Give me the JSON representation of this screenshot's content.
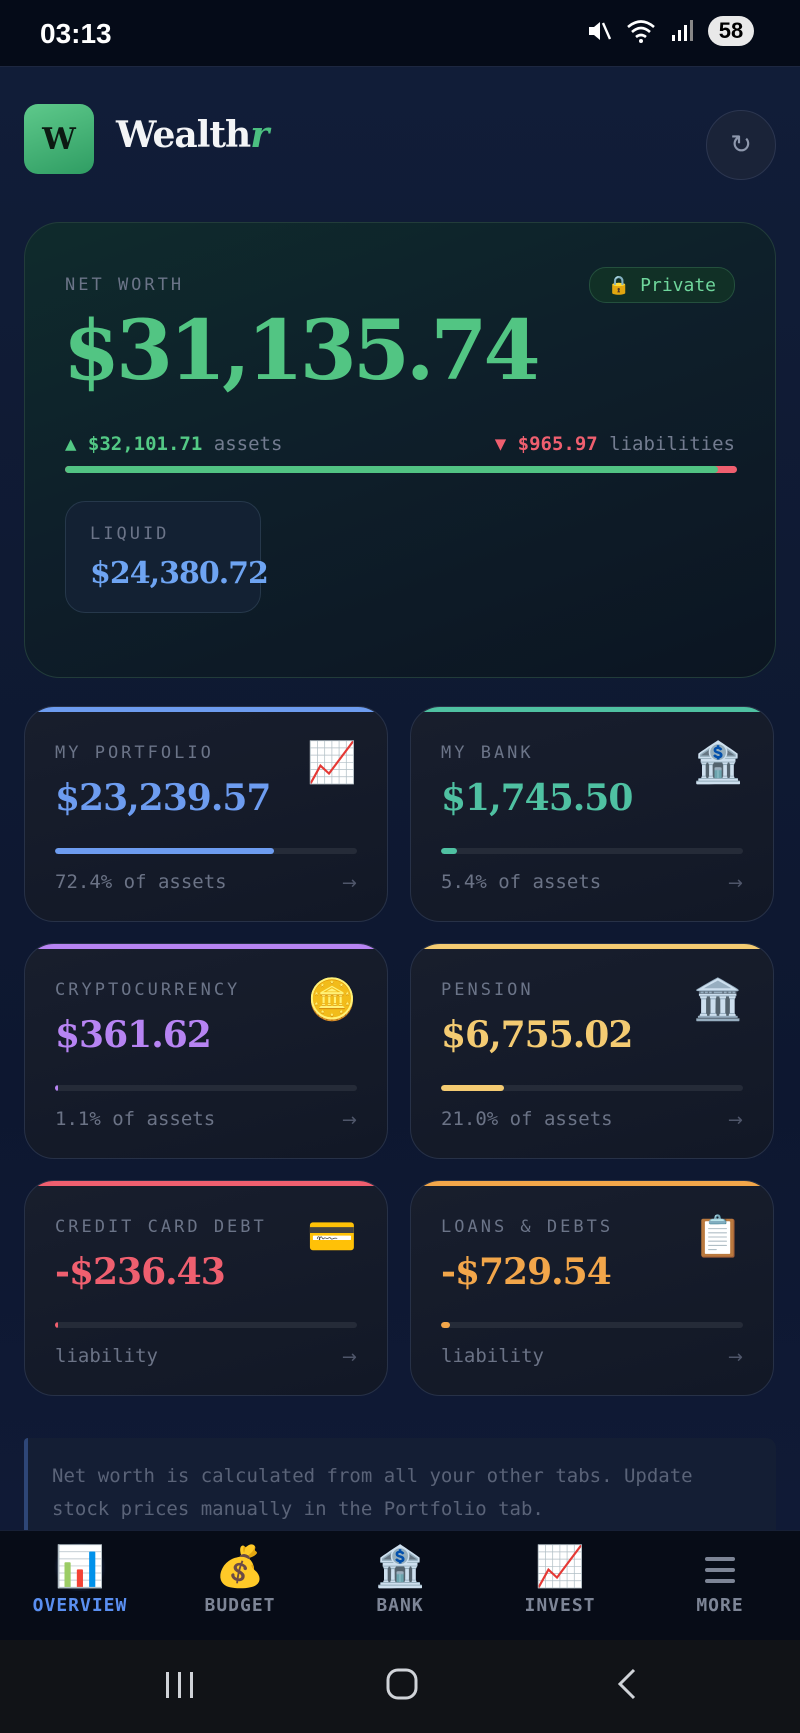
{
  "status_bar": {
    "time": "03:13",
    "battery": "58"
  },
  "header": {
    "logo_letter": "W",
    "app_name_main": "Wealth",
    "app_name_accent": "r",
    "refresh_glyph": "↻"
  },
  "net_worth": {
    "label": "NET WORTH",
    "privacy_badge": "Private",
    "amount": "$31,135.74",
    "assets_value": "$32,101.71",
    "assets_word": "assets",
    "liabilities_value": "$965.97",
    "liabilities_word": "liabilities",
    "assets_share_percent": 97.1,
    "liquid_label": "LIQUID",
    "liquid_amount": "$24,380.72"
  },
  "tiles": [
    {
      "label": "MY PORTFOLIO",
      "icon": "chart-up-icon",
      "emoji": "📈",
      "amount": "$23,239.57",
      "footer": "72.4% of assets",
      "percent": 72.4,
      "color": "#6d9cf0"
    },
    {
      "label": "MY BANK",
      "icon": "bank-icon",
      "emoji": "🏦",
      "amount": "$1,745.50",
      "footer": "5.4% of assets",
      "percent": 5.4,
      "color": "#4fc1a2"
    },
    {
      "label": "CRYPTOCURRENCY",
      "icon": "coin-icon",
      "emoji": "🪙",
      "amount": "$361.62",
      "footer": "1.1% of assets",
      "percent": 1.1,
      "color": "#b784f3"
    },
    {
      "label": "PENSION",
      "icon": "classical-building-icon",
      "emoji": "🏛️",
      "amount": "$6,755.02",
      "footer": "21.0% of assets",
      "percent": 21.0,
      "color": "#f4cb72"
    },
    {
      "label": "CREDIT CARD DEBT",
      "icon": "credit-card-icon",
      "emoji": "💳",
      "amount": "-$236.43",
      "footer": "liability",
      "percent": 1.0,
      "color": "#ef5f6f"
    },
    {
      "label": "LOANS & DEBTS",
      "icon": "clipboard-icon",
      "emoji": "📋",
      "amount": "-$729.54",
      "footer": "liability",
      "percent": 3.0,
      "color": "#f2a64a"
    }
  ],
  "tile_arrow": "→",
  "note": "Net worth is calculated from all your other tabs. Update stock prices manually in the Portfolio tab.",
  "nav": [
    {
      "label": "OVERVIEW",
      "icon": "bar-chart-icon",
      "emoji": "📊",
      "active": true
    },
    {
      "label": "BUDGET",
      "icon": "money-bag-icon",
      "emoji": "💰",
      "active": false
    },
    {
      "label": "BANK",
      "icon": "bank-icon",
      "emoji": "🏦",
      "active": false
    },
    {
      "label": "INVEST",
      "icon": "chart-up-icon",
      "emoji": "📈",
      "active": false
    },
    {
      "label": "MORE",
      "icon": "hamburger-menu-icon",
      "emoji": "",
      "active": false
    }
  ]
}
